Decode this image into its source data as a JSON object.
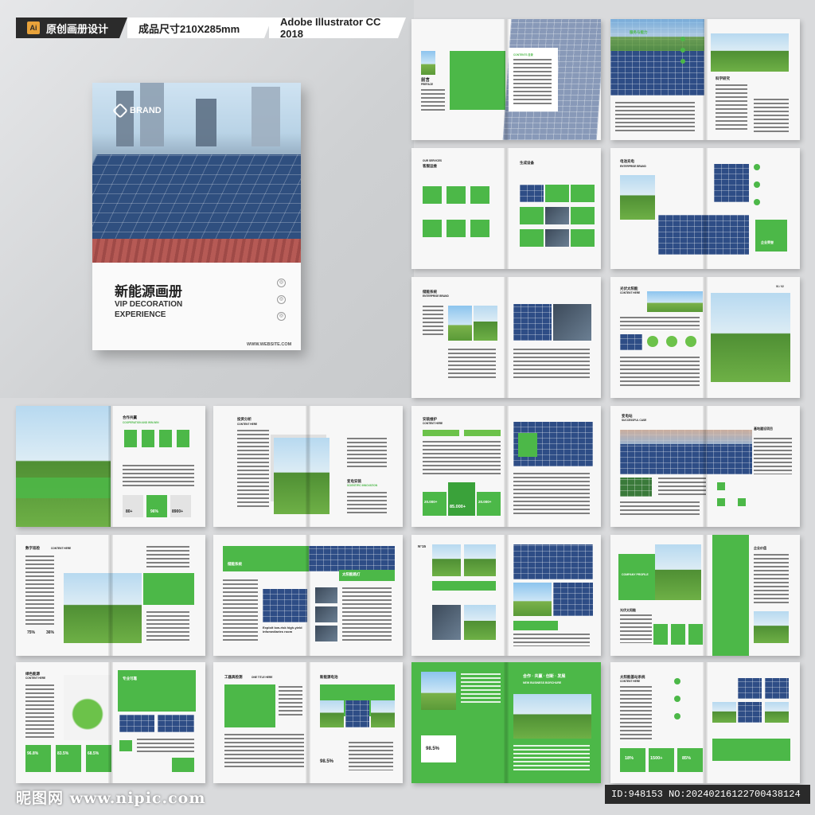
{
  "header": {
    "tag1": "原创画册设计",
    "tag1_icon": "Ai",
    "tag2": "成品尺寸210X285mm",
    "tag3": "Adobe Illustrator CC 2018"
  },
  "cover": {
    "brand": "BRAND",
    "title_cn": "新能源画册",
    "title_en_1": "VIP DECORATION",
    "title_en_2": "EXPERIENCE",
    "website": "WWW.WEBSITE.COM"
  },
  "spreads": {
    "s1": {
      "title": "前言",
      "sub": "PREFACE",
      "contents": "CONTENTS 目录"
    },
    "s2": {
      "title": "服务与能力",
      "tech": "科学研究"
    },
    "s3": {
      "title": "客服运维",
      "sub": "OUR SERVICES",
      "right": "生成设备"
    },
    "s4": {
      "title": "电池充电",
      "sub": "ENTERPRISE BRAND",
      "right": "企业荣誉"
    },
    "s5": {
      "title": "储能系统",
      "sub": "ENTERPRISE BRAND"
    },
    "s6": {
      "title": "光伏太阳能",
      "sub": "CONTENT HERE",
      "page": "01 / 02"
    },
    "s7": {
      "title": "合作共赢",
      "sub": "COOPERATION AND WIN-WIN",
      "n1": "80+",
      "n2": "96%",
      "n3": "8900+"
    },
    "s8": {
      "title": "投资分析",
      "sub": "CONTENT HERE",
      "right": "变电安装",
      "right_sub": "SCIENTIFIC INNOVATION"
    },
    "s9": {
      "title": "安装维护",
      "sub": "CONTENT HERE",
      "n1": "20.000+",
      "n2": "85.000+",
      "n3": "20.000+"
    },
    "s10": {
      "title": "变电站",
      "sub": "SUCCESSFUL CASE",
      "right": "基地建设项目"
    },
    "s11": {
      "title": "数字巡检",
      "sub": "CONTENT HERE",
      "n1": "75%",
      "n2": "36%"
    },
    "s12": {
      "title": "储能系统",
      "sub": "CONTENT HERE",
      "right": "太阳能路灯",
      "note": "Exploit low-risk high-yield infomediaries room"
    },
    "s13": {
      "title": "N°15",
      "sub": "CONTENT HERE"
    },
    "s14": {
      "title": "COMPANY PROFILE",
      "sub": "光伏太阳能",
      "right": "企业价值"
    },
    "s15": {
      "title": "绿色能源",
      "sub": "CONTENT HERE",
      "right": "专业可靠",
      "n1": "96.8%",
      "n2": "83.5%",
      "n3": "68.5%"
    },
    "s16": {
      "title": "工器具检测",
      "sub": "ONE TITLE HERE",
      "right": "新能源电池",
      "n1": "98.5%"
    },
    "s17": {
      "title": "合作 · 共赢 · 创新 · 发展",
      "sub": "NEW BUSINESS BORCHURE",
      "n1": "98.5%"
    },
    "s18": {
      "title": "太阳能基站系统",
      "sub": "CONTENT HERE",
      "n1": "18%",
      "n2": "1500+",
      "n3": "85%"
    }
  },
  "footer": {
    "watermark": "昵图网 www.nipic.com",
    "id": "ID:948153 NO:20240216122700438124"
  }
}
